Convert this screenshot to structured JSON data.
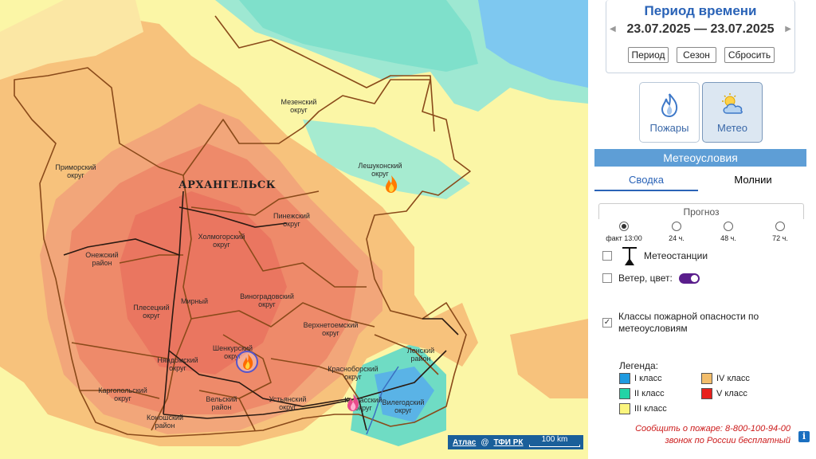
{
  "map": {
    "city": "АРХАНГЕЛЬСК",
    "districts": [
      {
        "label": "Мезенский\nокруг"
      },
      {
        "label": "Лешуконский\nокруг"
      },
      {
        "label": "Приморский\nокруг"
      },
      {
        "label": "Пинежский\nокруг"
      },
      {
        "label": "Холмогорский\nокруг"
      },
      {
        "label": "Онежский\nрайон"
      },
      {
        "label": "Мирный"
      },
      {
        "label": "Плесецкий\nокруг"
      },
      {
        "label": "Виноградовский\nокруг"
      },
      {
        "label": "Верхнетоемский\nокруг"
      },
      {
        "label": "Шенкурский\nокруг"
      },
      {
        "label": "Няндомский\nокруг"
      },
      {
        "label": "Ленский\nрайон"
      },
      {
        "label": "Красноборский\nокруг"
      },
      {
        "label": "Каргопольский\nокруг"
      },
      {
        "label": "Вельский\nрайон"
      },
      {
        "label": "Устьянский\nокруг"
      },
      {
        "label": "Котласский\nокруг"
      },
      {
        "label": "Вилегодский\nокруг"
      },
      {
        "label": "Коношский\nрайон"
      }
    ],
    "attribution_link": "Атлас",
    "attribution_sep": "@",
    "attribution_org": "ТФИ РК",
    "scale_label": "100 km"
  },
  "panel": {
    "period_title": "Период времени",
    "date_from": "23.07.2025",
    "date_sep": "—",
    "date_to": "23.07.2025",
    "buttons": [
      "Период",
      "Сезон",
      "Сбросить"
    ],
    "modes": [
      {
        "label": "Пожары",
        "icon": "fire-icon",
        "active": false
      },
      {
        "label": "Метео",
        "icon": "cloud-sun-icon",
        "active": true
      }
    ],
    "section_title": "Метеоусловия",
    "tabs": [
      "Сводка",
      "Молнии"
    ],
    "forecast_title": "Прогноз",
    "forecast_options": [
      "факт 13:00",
      "24 ч.",
      "48 ч.",
      "72 ч."
    ],
    "forecast_selected": 0,
    "meteostations_label": "Метеостанции",
    "meteostations_checked": false,
    "wind_label": "Ветер, цвет:",
    "wind_checked": false,
    "wind_color_toggle": true,
    "fire_classes_label": "Классы пожарной опасности по метеоусловиям",
    "fire_classes_checked": true,
    "legend_title": "Легенда:",
    "legend": [
      {
        "label": "I класс",
        "color": "#1e9ae0"
      },
      {
        "label": "IV класс",
        "color": "#f2bd6b"
      },
      {
        "label": "II класс",
        "color": "#23d4a6"
      },
      {
        "label": "V класс",
        "color": "#e8201c"
      },
      {
        "label": "III класс",
        "color": "#fbf57d"
      }
    ],
    "report_line1": "Сообщить о пожаре: 8-800-100-94-00",
    "report_line2": "звонок по России бесплатный",
    "info": "i"
  }
}
